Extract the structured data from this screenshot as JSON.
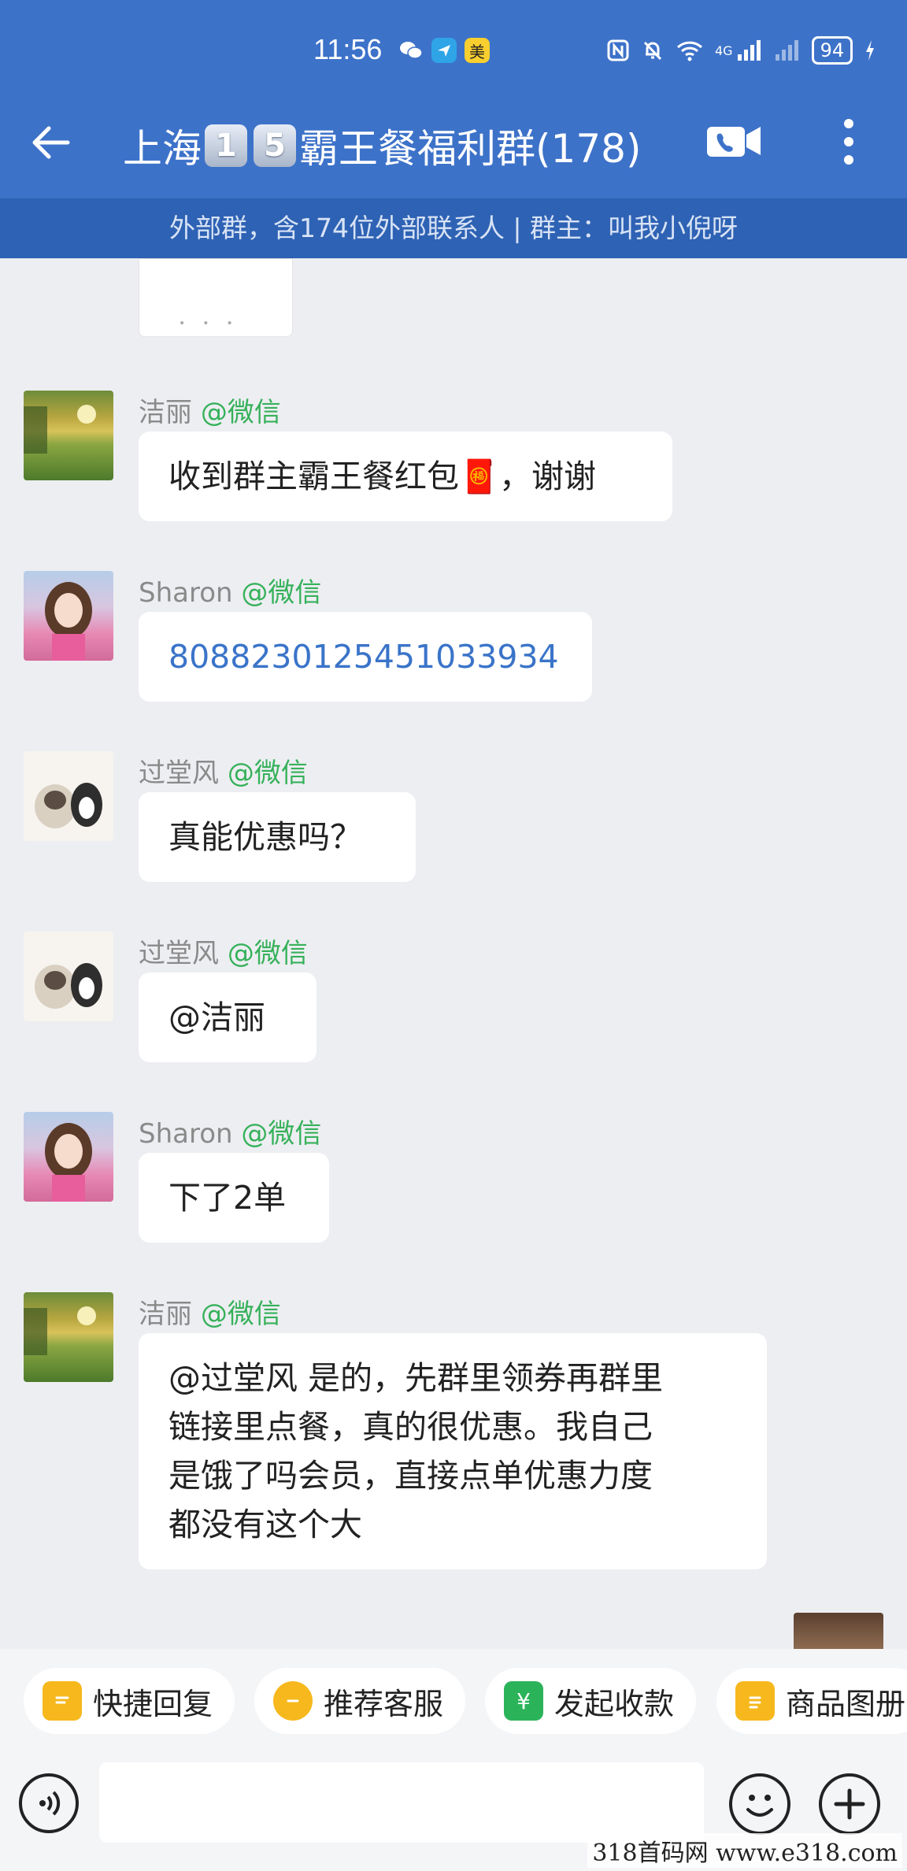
{
  "status_bar": {
    "time": "11:56",
    "app_badge": "美",
    "network": "4G",
    "battery": "94"
  },
  "header": {
    "title_prefix": "上海",
    "title_key1": "1",
    "title_key2": "5",
    "title_suffix": "霸王餐福利群(178)",
    "subtitle": "外部群，含174位外部联系人 | 群主：叫我小倪呀"
  },
  "messages": [
    {
      "name": "洁丽",
      "source": "@微信",
      "text": "收到群主霸王餐红包🧧，谢谢",
      "avatar": "field-sunset-avatar"
    },
    {
      "name": "Sharon",
      "source": "@微信",
      "text": "808823012545103393​4",
      "avatar": "cartoon-girl-avatar"
    },
    {
      "name": "过堂风",
      "source": "@微信",
      "text": "真能优惠吗？",
      "avatar": "dog-cat-avatar"
    },
    {
      "name": "过堂风",
      "source": "@微信",
      "text": "@洁丽",
      "avatar": "dog-cat-avatar"
    },
    {
      "name": "Sharon",
      "source": "@微信",
      "text": "下了2单",
      "avatar": "cartoon-girl-avatar"
    },
    {
      "name": "洁丽",
      "source": "@微信",
      "text_lines": [
        "@过堂风 是的，先群里领券再群里",
        "链接里点餐，真的很优惠。我自己",
        "是饿了吗会员，直接点单优惠力度",
        "都没有这个大"
      ],
      "avatar": "field-sunset-avatar"
    }
  ],
  "quick_actions": [
    "快捷回复",
    "推荐客服",
    "发起收款",
    "商品图册"
  ],
  "colors": {
    "header": "#3d72c9",
    "subheader": "#2e62b4",
    "source_green": "#36b15a",
    "link_blue": "#3a74c9"
  },
  "watermark": "318首码网 www.e318.com"
}
